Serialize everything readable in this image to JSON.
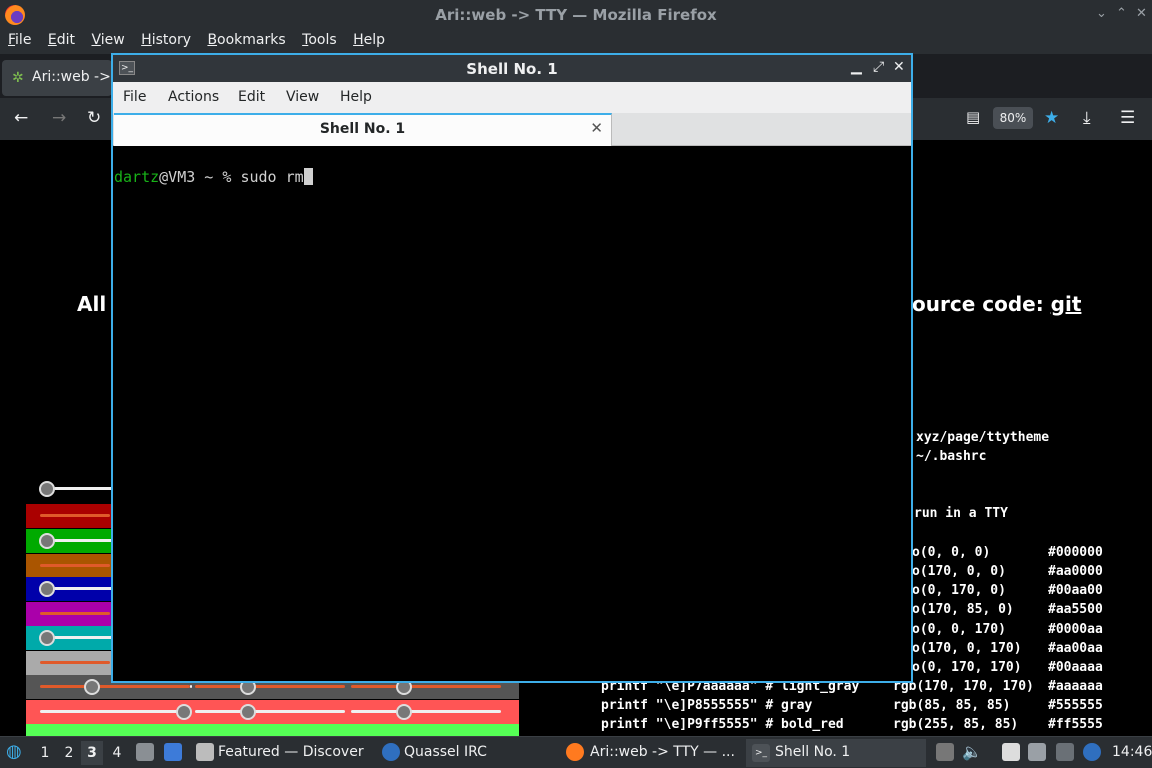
{
  "firefox": {
    "window_title": "Ari::web -> TTY — Mozilla Firefox",
    "menu": [
      "File",
      "Edit",
      "View",
      "History",
      "Bookmarks",
      "Tools",
      "Help"
    ],
    "tab_label": "Ari::web ->",
    "zoom": "80%"
  },
  "page": {
    "heading_left": "All",
    "heading_right_prefix": "ource code: ",
    "heading_right_link": "git",
    "lines": [
      "xyz/page/ttytheme",
      "~/.bashrc",
      "run in a TTY"
    ],
    "color_rows": [
      {
        "prefix": "",
        "name": "",
        "rgb": "o(0, 0, 0)",
        "hex": "#000000"
      },
      {
        "prefix": "",
        "name": "",
        "rgb": "o(170, 0, 0)",
        "hex": "#aa0000"
      },
      {
        "prefix": "",
        "name": "",
        "rgb": "o(0, 170, 0)",
        "hex": "#00aa00"
      },
      {
        "prefix": "",
        "name": "",
        "rgb": "o(170, 85, 0)",
        "hex": "#aa5500"
      },
      {
        "prefix": "",
        "name": "",
        "rgb": "o(0, 0, 170)",
        "hex": "#0000aa"
      },
      {
        "prefix": "",
        "name": "",
        "rgb": "o(170, 0, 170)",
        "hex": "#aa00aa"
      },
      {
        "prefix": "",
        "name": "",
        "rgb": "o(0, 170, 170)",
        "hex": "#00aaaa"
      },
      {
        "prefix": "printf \"\\e]P7aaaaaa\" # light_gray",
        "rgb": "rgb(170, 170, 170)",
        "hex": "#aaaaaa"
      },
      {
        "prefix": "printf \"\\e]P8555555\" # gray",
        "rgb": "rgb(85, 85, 85)",
        "hex": "#555555"
      },
      {
        "prefix": "printf \"\\e]P9ff5555\" # bold_red",
        "rgb": "rgb(255, 85, 85)",
        "hex": "#ff5555"
      }
    ],
    "swatches": [
      "#aa0000",
      "#00aa00",
      "#aa5500",
      "#0000aa",
      "#aa00aa",
      "#00aaaa",
      "#aaaaaa",
      "#555555",
      "#ff5555",
      "#55ff55"
    ]
  },
  "konsole": {
    "window_title": "Shell No. 1",
    "menu": [
      "File",
      "Actions",
      "Edit",
      "View",
      "Help"
    ],
    "tab_label": "Shell No. 1",
    "prompt_user": "dartz",
    "prompt_rest": "@VM3 ~ % ",
    "command": "sudo rm"
  },
  "taskbar": {
    "desktops": [
      "1",
      "2",
      "3",
      "4"
    ],
    "tasks": [
      "Featured — Discover",
      "Quassel IRC",
      "Ari::web -> TTY — ...",
      "Shell No. 1"
    ],
    "clock": "14:46"
  }
}
